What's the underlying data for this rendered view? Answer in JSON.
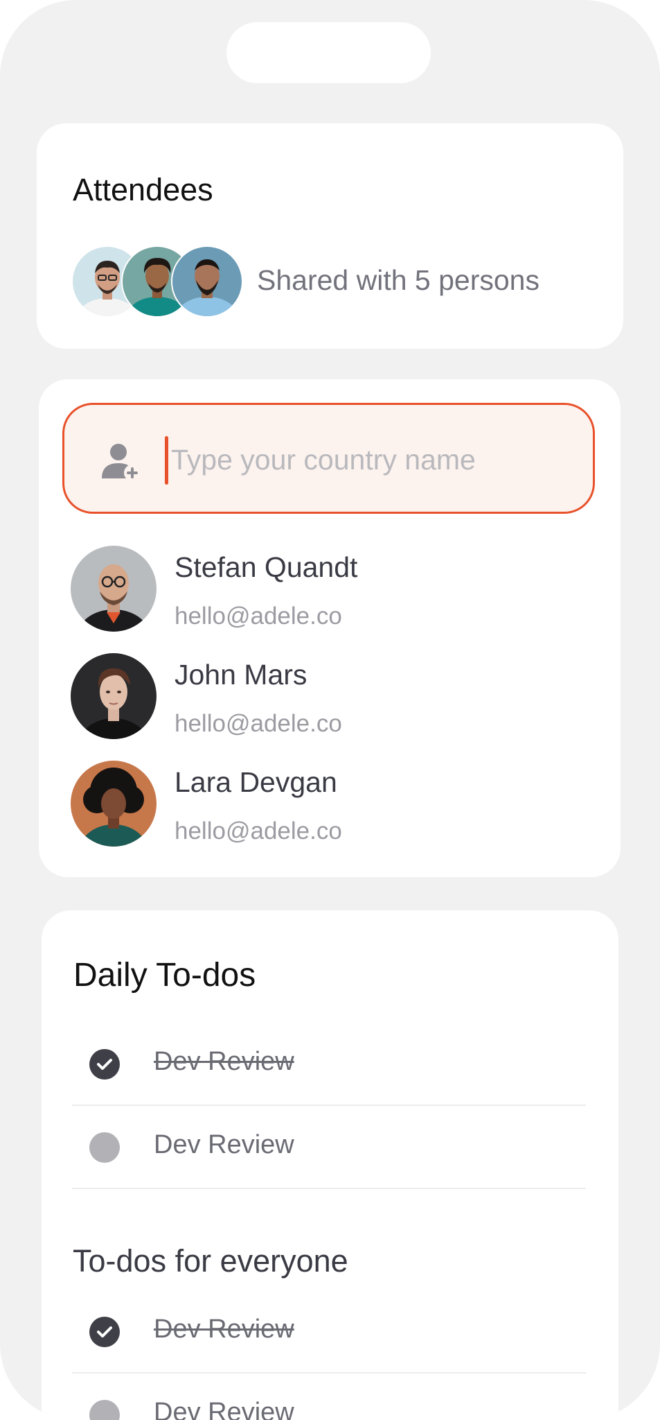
{
  "attendees": {
    "title": "Attendees",
    "shared_text": "Shared with 5 persons"
  },
  "search": {
    "placeholder": "Type your country name",
    "value": ""
  },
  "contacts": [
    {
      "name": "Stefan Quandt",
      "email": "hello@adele.co"
    },
    {
      "name": "John Mars",
      "email": "hello@adele.co"
    },
    {
      "name": "Lara Devgan",
      "email": "hello@adele.co"
    }
  ],
  "todos": {
    "title": "Daily To-dos",
    "items": [
      {
        "label": "Dev Review",
        "done": true
      },
      {
        "label": "Dev Review",
        "done": false
      }
    ],
    "everyone_title": "To-dos for everyone",
    "everyone_items": [
      {
        "label": "Dev Review",
        "done": true
      },
      {
        "label": "Dev Review",
        "done": false
      }
    ]
  },
  "icons": {
    "add_user": "add-user-icon",
    "check": "check-icon"
  },
  "colors": {
    "accent": "#e8512a",
    "input_bg": "#fcf2ee",
    "check_done": "#3f3f48",
    "check_open": "#b1b1b6"
  }
}
